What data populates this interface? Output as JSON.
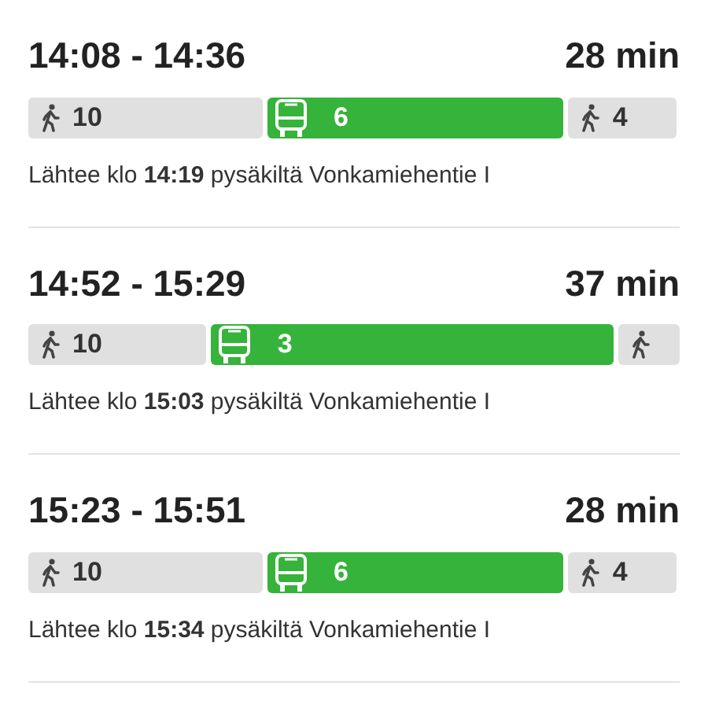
{
  "itineraries": [
    {
      "time_range": "14:08 - 14:36",
      "duration": "28 min",
      "legs": [
        {
          "kind": "walk",
          "label": "10"
        },
        {
          "kind": "bus",
          "label": "6"
        },
        {
          "kind": "walk",
          "label": "4"
        }
      ],
      "departure": "Lähtee klo **14:19** pysäkiltä Vonkamiehentie I"
    },
    {
      "time_range": "14:52 - 15:29",
      "duration": "37 min",
      "legs": [
        {
          "kind": "walk",
          "label": "10"
        },
        {
          "kind": "bus",
          "label": "3"
        },
        {
          "kind": "walk"
        }
      ],
      "departure": "Lähtee klo **15:03** pysäkiltä Vonkamiehentie I"
    },
    {
      "time_range": "15:23 - 15:51",
      "duration": "28 min",
      "legs": [
        {
          "kind": "walk",
          "label": "10"
        },
        {
          "kind": "bus",
          "label": "6"
        },
        {
          "kind": "walk",
          "label": "4"
        }
      ],
      "departure": "Lähtee klo **15:34** pysäkiltä Vonkamiehentie I"
    }
  ]
}
